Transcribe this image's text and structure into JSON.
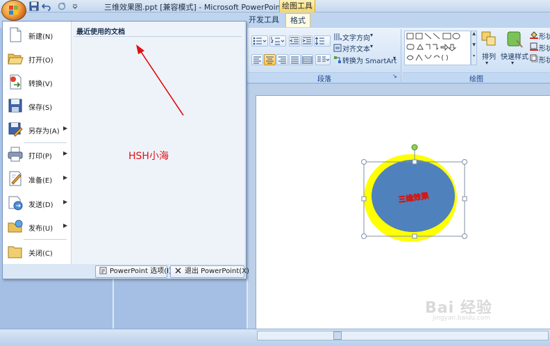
{
  "window": {
    "title": "三维效果图.ppt [兼容模式] - Microsoft PowerPoint",
    "context_tab_label": "绘图工具"
  },
  "ribbon": {
    "tabs": [
      {
        "label": "开发工具",
        "active": false
      },
      {
        "label": "格式",
        "active": true
      }
    ],
    "paragraph": {
      "text_direction": "文字方向",
      "align_text": "对齐文本",
      "convert_smartart": "转换为 SmartArt",
      "group_label": "段落"
    },
    "drawing": {
      "arrange_label": "排列",
      "quick_styles_label": "快速样式",
      "shape_fill": "形状",
      "shape_outline": "形状",
      "shape_effects": "形状",
      "group_label": "绘图"
    }
  },
  "office_menu": {
    "recent_header": "最近使用的文档",
    "items": [
      {
        "label": "新建(N)",
        "icon": "new-document-icon",
        "submenu": false
      },
      {
        "label": "打开(O)",
        "icon": "open-folder-icon",
        "submenu": false
      },
      {
        "label": "转换(V)",
        "icon": "convert-icon",
        "submenu": false
      },
      {
        "label": "保存(S)",
        "icon": "save-icon",
        "submenu": false
      },
      {
        "label": "另存为(A)",
        "icon": "save-as-icon",
        "submenu": true
      },
      {
        "label": "打印(P)",
        "icon": "print-icon",
        "submenu": true
      },
      {
        "label": "准备(E)",
        "icon": "prepare-icon",
        "submenu": true
      },
      {
        "label": "发送(D)",
        "icon": "send-icon",
        "submenu": true
      },
      {
        "label": "发布(U)",
        "icon": "publish-icon",
        "submenu": true
      },
      {
        "label": "关闭(C)",
        "icon": "close-folder-icon",
        "submenu": false
      }
    ],
    "options_button": "PowerPoint 选项(I)",
    "exit_button": "退出 PowerPoint(X)"
  },
  "annotation": {
    "text": "HSH小海",
    "color": "#e01010"
  },
  "slide": {
    "shape_text": "三维效果",
    "outer_color": "#ffff00",
    "inner_color": "#4f81bd",
    "text_color": "#e01010"
  },
  "watermark": {
    "text": "Bai 经验",
    "sub": "jingyan.baidu.com"
  }
}
